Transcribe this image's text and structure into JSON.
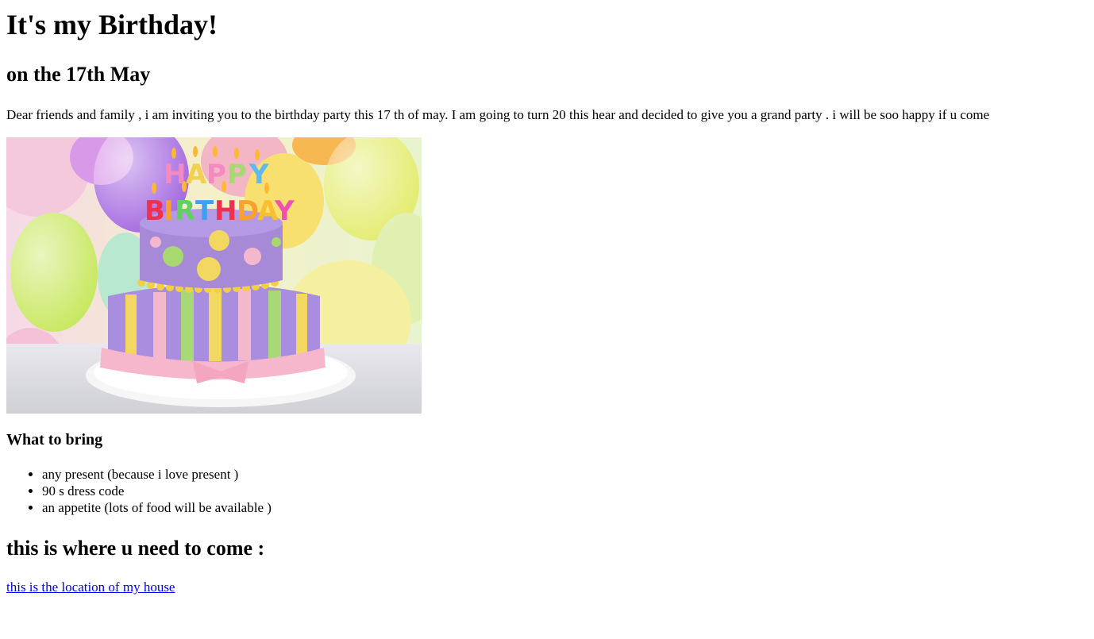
{
  "heading": "It's my Birthday!",
  "subheading": "on the 17th May",
  "intro": "Dear friends and family , i am inviting you to the birthday party this 17 th of may. I am going to turn 20 this hear and decided to give you a grand party . i will be soo happy if u come",
  "image": {
    "alt": "birthday cake",
    "candles_text_line1": "HAPPY",
    "candles_text_line2": "BIRTHDAY"
  },
  "bring": {
    "title": "What to bring",
    "items": [
      "any present (because i love present )",
      "90 s dress code",
      "an appetite (lots of food will be available )"
    ]
  },
  "where": {
    "title": "this is where u need to come :",
    "link_text": "this is the location of my house"
  },
  "colors": {
    "link": "#0000ee",
    "text": "#000000"
  }
}
